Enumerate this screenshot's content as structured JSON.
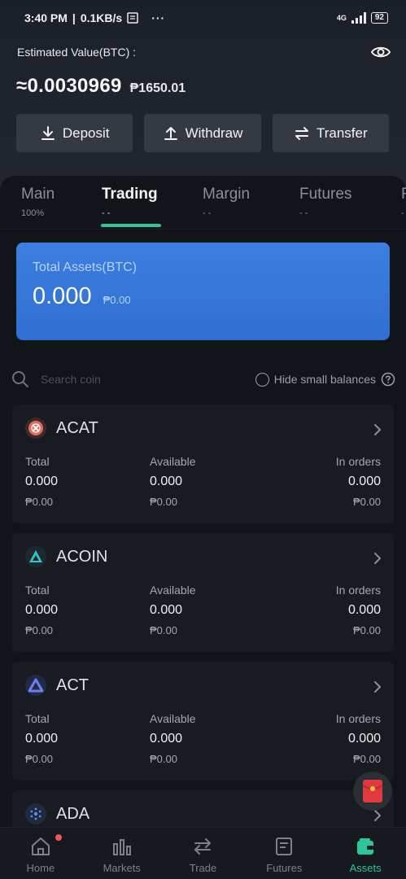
{
  "status": {
    "time": "3:40 PM",
    "speed": "0.1KB/s",
    "more": "···",
    "network": "4G",
    "battery": "92"
  },
  "header": {
    "estimated_label": "Estimated Value(BTC) :",
    "btc_value": "≈0.0030969",
    "php_value": "₱1650.01"
  },
  "actions": {
    "deposit": "Deposit",
    "withdraw": "Withdraw",
    "transfer": "Transfer"
  },
  "tabs": [
    {
      "label": "Main",
      "sub": "100%"
    },
    {
      "label": "Trading",
      "sub": "- -"
    },
    {
      "label": "Margin",
      "sub": "- -"
    },
    {
      "label": "Futures",
      "sub": "- -"
    },
    {
      "label": "F",
      "sub": "-"
    }
  ],
  "total_assets": {
    "label": "Total Assets(BTC)",
    "value": "0.000",
    "php": "₱0.00"
  },
  "search": {
    "placeholder": "Search coin",
    "hide_small_label": "Hide small balances"
  },
  "coins": [
    {
      "name": "ACAT",
      "total_label": "Total",
      "available_label": "Available",
      "orders_label": "In orders",
      "total": "0.000",
      "total_php": "₱0.00",
      "available": "0.000",
      "available_php": "₱0.00",
      "orders": "0.000",
      "orders_php": "₱0.00"
    },
    {
      "name": "ACOIN",
      "total_label": "Total",
      "available_label": "Available",
      "orders_label": "In orders",
      "total": "0.000",
      "total_php": "₱0.00",
      "available": "0.000",
      "available_php": "₱0.00",
      "orders": "0.000",
      "orders_php": "₱0.00"
    },
    {
      "name": "ACT",
      "total_label": "Total",
      "available_label": "Available",
      "orders_label": "In orders",
      "total": "0.000",
      "total_php": "₱0.00",
      "available": "0.000",
      "available_php": "₱0.00",
      "orders": "0.000",
      "orders_php": "₱0.00"
    },
    {
      "name": "ADA"
    }
  ],
  "nav": [
    {
      "label": "Home",
      "icon": "home-icon"
    },
    {
      "label": "Markets",
      "icon": "markets-icon"
    },
    {
      "label": "Trade",
      "icon": "trade-icon"
    },
    {
      "label": "Futures",
      "icon": "futures-icon"
    },
    {
      "label": "Assets",
      "icon": "assets-icon"
    }
  ],
  "colors": {
    "accent": "#2ec4a0",
    "card_blue": "#3676d8",
    "background": "#111418"
  }
}
